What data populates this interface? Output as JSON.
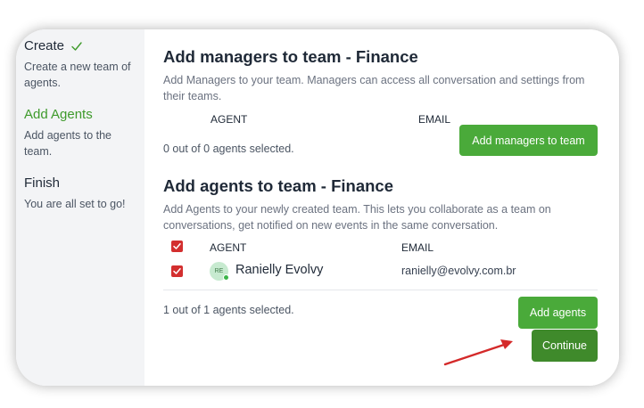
{
  "sidebar": {
    "steps": [
      {
        "title": "Create",
        "description": "Create a new team of agents.",
        "status": "done"
      },
      {
        "title": "Add Agents",
        "description": "Add agents to the team.",
        "status": "active"
      },
      {
        "title": "Finish",
        "description": "You are all set to go!",
        "status": "pending"
      }
    ]
  },
  "managers": {
    "title": "Add managers to team - Finance",
    "description": "Add Managers to your team. Managers can access all conversation and settings from their teams.",
    "columns": {
      "agent": "AGENT",
      "email": "EMAIL"
    },
    "selected_text": "0 out of 0 agents selected.",
    "button_label": "Add managers to team"
  },
  "agents": {
    "title": "Add agents to team - Finance",
    "description": "Add Agents to your newly created team. This lets you collaborate as a team on conversations, get notified on new events in the same conversation.",
    "columns": {
      "agent": "AGENT",
      "email": "EMAIL"
    },
    "rows": [
      {
        "initials": "RE",
        "name": "Ranielly Evolvy",
        "email": "ranielly@evolvy.com.br",
        "checked": true,
        "online": true
      }
    ],
    "selected_text": "1 out of 1 agents selected.",
    "button_label": "Add agents"
  },
  "continue_label": "Continue",
  "colors": {
    "accent": "#4aaa3a",
    "accent_dark": "#3f8a2b",
    "checkbox": "#d32f2f",
    "annotation_arrow": "#d42a2a"
  },
  "icons": {
    "done_step": "check-icon",
    "checkbox": "checkbox-checked-icon",
    "annotation": "red-arrow"
  }
}
